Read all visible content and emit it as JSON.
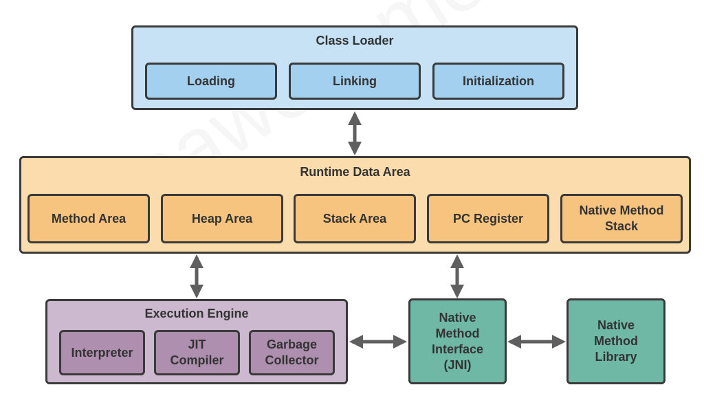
{
  "diagram": {
    "class_loader": {
      "title": "Class Loader",
      "items": [
        "Loading",
        "Linking",
        "Initialization"
      ]
    },
    "runtime_data_area": {
      "title": "Runtime Data Area",
      "items": [
        "Method Area",
        "Heap Area",
        "Stack Area",
        "PC Register",
        "Native Method\nStack"
      ]
    },
    "execution_engine": {
      "title": "Execution Engine",
      "items": [
        "Interpreter",
        "JIT\nCompiler",
        "Garbage\nCollector"
      ]
    },
    "jni": {
      "label": "Native\nMethod\nInterface\n(JNI)"
    },
    "native_library": {
      "label": "Native\nMethod\nLibrary"
    },
    "watermark": "theawesomenayak",
    "colors": {
      "class_loader_outer": "#c7e2f5",
      "class_loader_inner": "#a3d0ef",
      "runtime_outer": "#fadcad",
      "runtime_inner": "#f6c47f",
      "execution_outer": "#ccb8cf",
      "execution_inner": "#ae8fb0",
      "native": "#6fb8a6",
      "border": "#3a3a3a",
      "arrow": "#5f5f5f"
    }
  }
}
